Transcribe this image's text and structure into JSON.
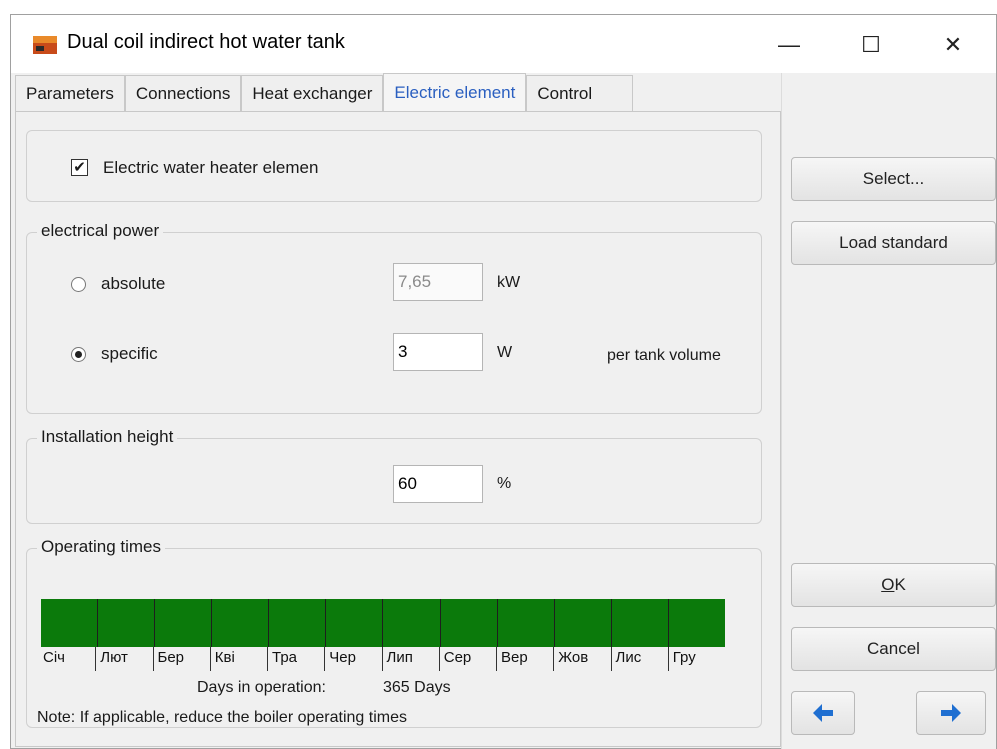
{
  "window": {
    "title": "Dual coil indirect hot water tank",
    "controls": {
      "minimize": "—",
      "maximize": "☐",
      "close": "✕"
    }
  },
  "tabs": [
    {
      "label": "Parameters",
      "active": false
    },
    {
      "label": "Connections",
      "active": false
    },
    {
      "label": "Heat exchanger",
      "active": false
    },
    {
      "label": "Electric element",
      "active": true
    },
    {
      "label": "Control",
      "active": false
    }
  ],
  "electric_heater": {
    "label": "Electric water heater elemen",
    "checked": true,
    "check_glyph": "✔"
  },
  "electrical_power": {
    "legend": "electrical power",
    "absolute": {
      "label": "absolute",
      "value": "7,65",
      "unit": "kW",
      "selected": false
    },
    "specific": {
      "label": "specific",
      "value": "3",
      "unit": "W",
      "suffix": "per tank volume",
      "selected": true
    }
  },
  "installation_height": {
    "legend": "Installation height",
    "value": "60",
    "unit": "%"
  },
  "operating_times": {
    "legend": "Operating times",
    "months": [
      "Січ",
      "Лют",
      "Бер",
      "Кві",
      "Тра",
      "Чер",
      "Лип",
      "Сер",
      "Вер",
      "Жов",
      "Лис",
      "Гру"
    ],
    "bar_color": "#0b7a0b",
    "days_label": "Days in operation:",
    "days_value": "365 Days",
    "note": "Note: If applicable, reduce the boiler operating times"
  },
  "side_buttons": {
    "select": "Select...",
    "load_standard": "Load standard",
    "ok": "OK",
    "cancel": "Cancel",
    "back_icon": "arrow-left-icon",
    "forward_icon": "arrow-right-icon"
  },
  "colors": {
    "accent_tab": "#2a5fc0",
    "arrow": "#1f6fd1"
  }
}
